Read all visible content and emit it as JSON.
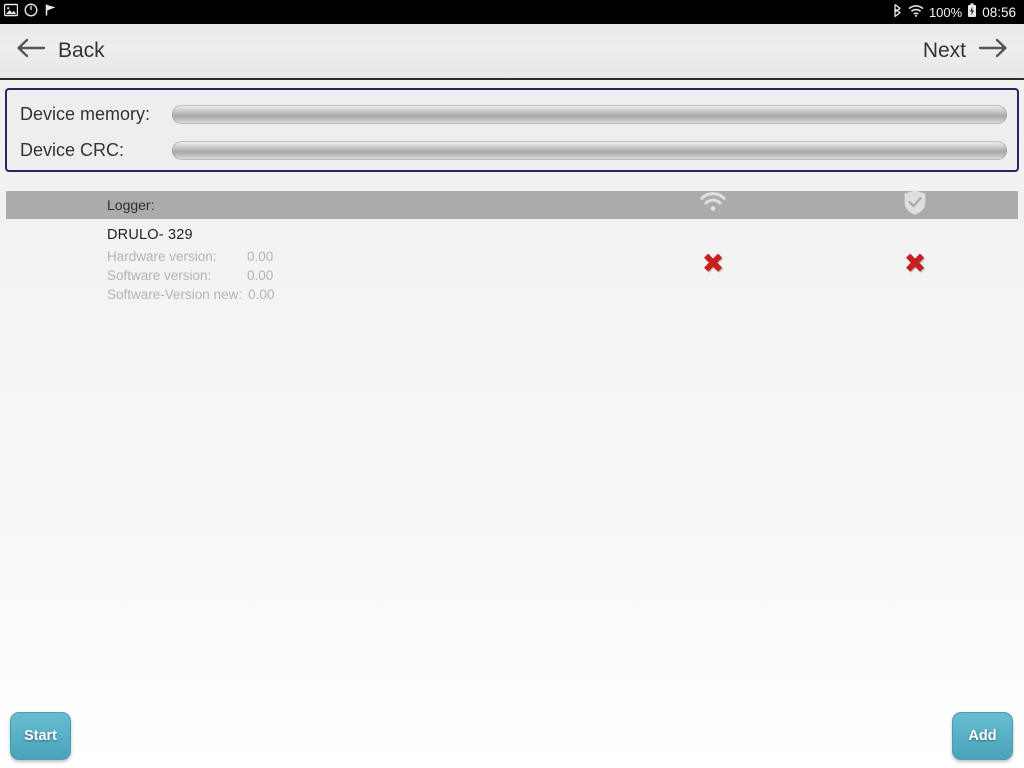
{
  "statusbar": {
    "left_icons": [
      "image-icon",
      "clock-icon",
      "flag-icon"
    ],
    "bluetooth_icon": "bluetooth-icon",
    "wifi_icon": "wifi-icon",
    "battery_percent": "100%",
    "battery_icon": "battery-charging-icon",
    "clock": "08:56"
  },
  "titlebar": {
    "back_label": "Back",
    "back_icon": "arrow-left-icon",
    "next_label": "Next",
    "next_icon": "arrow-right-icon"
  },
  "progress_panel": {
    "border_color": "#2a2458",
    "rows": [
      {
        "label": "Device memory:",
        "value": 0
      },
      {
        "label": "Device CRC:",
        "value": 0
      }
    ]
  },
  "list": {
    "header": {
      "title": "Logger:",
      "icons": [
        "wifi-signal-icon",
        "shield-check-icon"
      ],
      "background": "#ababab"
    },
    "rows": [
      {
        "name": "DRULO-  329",
        "specs": [
          {
            "key": "Hardware version:",
            "value": "0.00"
          },
          {
            "key": "Software version:",
            "value": "0.00"
          },
          {
            "key": "Software-Version new:",
            "value": "0.00"
          }
        ],
        "status_connection": "✖",
        "status_verified": "✖",
        "status_color": "#c81e1e"
      }
    ]
  },
  "footer": {
    "start_label": "Start",
    "add_label": "Add",
    "accent": "#5cb3c8"
  }
}
